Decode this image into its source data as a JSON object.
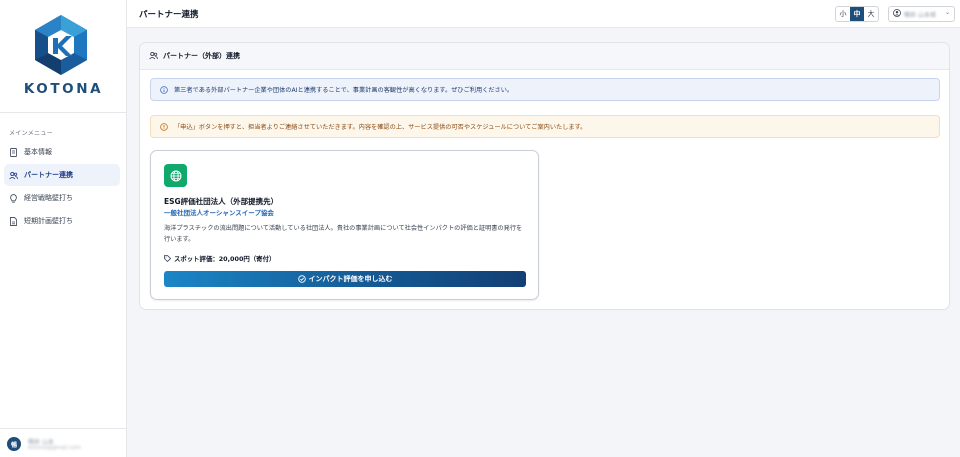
{
  "brand": {
    "name": "KOTONA",
    "primary_color": "#1e4e79"
  },
  "sidebar": {
    "menu_heading": "メインメニュー",
    "items": [
      {
        "label": "基本情報",
        "icon": "document-icon",
        "active": false
      },
      {
        "label": "パートナー連携",
        "icon": "users-icon",
        "active": true
      },
      {
        "label": "経営戦略壁打ち",
        "icon": "lightbulb-icon",
        "active": false
      },
      {
        "label": "短期計画壁打ち",
        "icon": "file-icon",
        "active": false
      }
    ],
    "user": {
      "avatar_initial": "暢",
      "name": "暢郎 山本",
      "email": "kotona@gmail.com"
    }
  },
  "header": {
    "title": "パートナー連携",
    "font_sizes": [
      "小",
      "中",
      "大"
    ],
    "selected_font_size": "中",
    "user_name": "暢郎 山本様"
  },
  "panel": {
    "title": "パートナー（外部）連携",
    "info_alert": "第三者である外部パートナー企業や団体のAIと連携することで、事業計画の客観性が高くなります。ぜひご利用ください。",
    "warn_alert": "「申込」ボタンを押すと、担当者よりご連絡させていただきます。内容を確認の上、サービス提供の可否やスケジュールについてご案内いたします。",
    "card": {
      "icon": "globe-icon",
      "icon_color": "#10a86b",
      "title": "ESG評価社団法人（外部提携先）",
      "organization": "一般社団法人オーシャンスイープ協会",
      "description": "海洋プラスチックの流出問題について活動している社団法人。貴社の事業計画について社会性インパクトの評価と証明書の発行を行います。",
      "price": "スポット評価：20,000円（寄付）",
      "apply_label": "インパクト評価を申し込む"
    }
  }
}
